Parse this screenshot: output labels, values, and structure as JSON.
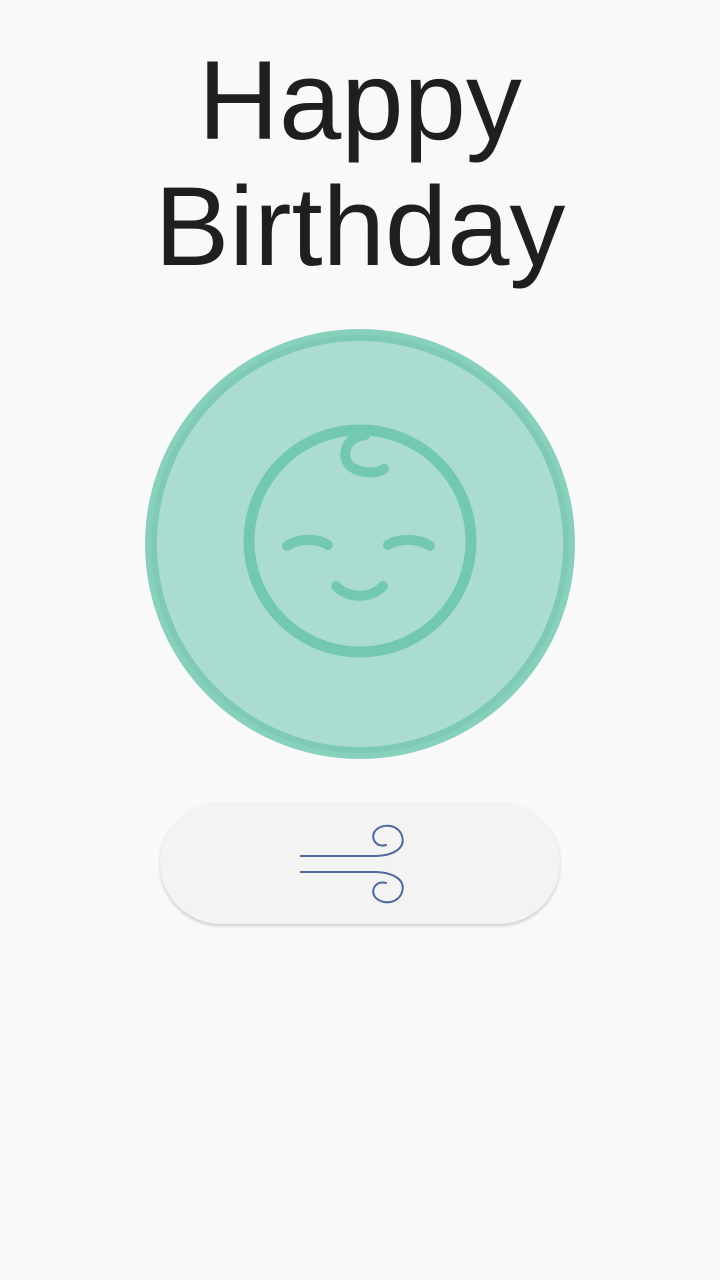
{
  "greeting": {
    "line1": "Happy",
    "line2": "Birthday"
  },
  "avatar": {
    "icon": "baby-face-icon",
    "fill_color": "#abdcd1",
    "ring_color": "#7ecab6",
    "stroke_color": "#73c8b1"
  },
  "blow_button": {
    "icon": "wind-icon",
    "icon_color": "#4d6a9a",
    "background": "#f3f3f3"
  }
}
